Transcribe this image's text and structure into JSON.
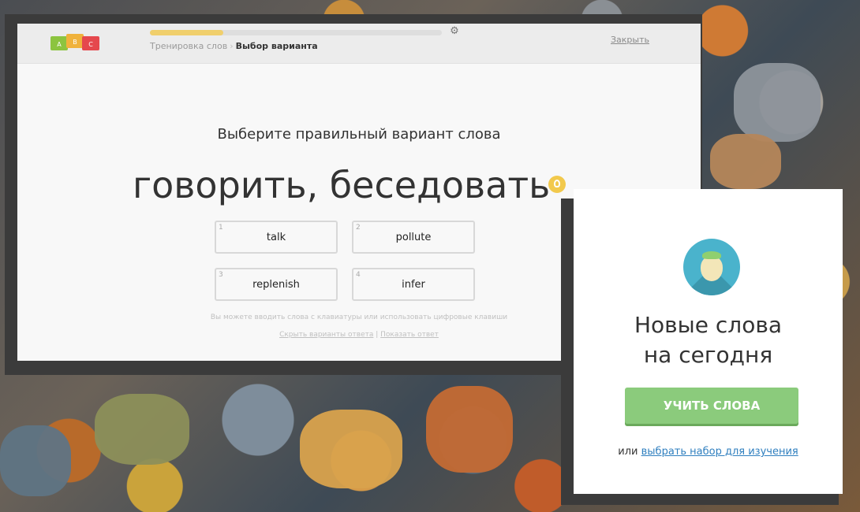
{
  "app": {
    "logo_letters": [
      "A",
      "B",
      "C"
    ],
    "logo_colors": [
      "#8cc43f",
      "#f0b23c",
      "#e5484d"
    ]
  },
  "header": {
    "progress_fraction": 0.25,
    "progress_color": "#f0cf6c",
    "settings_icon": "gear-icon",
    "breadcrumb": [
      "Тренировка слов",
      "Выбор варианта"
    ],
    "close_label": "Закрыть"
  },
  "exercise": {
    "instruction": "Выберите правильный вариант слова",
    "word": "говорить, беседовать",
    "hint_icon": "lightbulb-icon",
    "options": [
      {
        "num": "1",
        "label": "talk"
      },
      {
        "num": "2",
        "label": "pollute"
      },
      {
        "num": "3",
        "label": "replenish"
      },
      {
        "num": "4",
        "label": "infer"
      }
    ],
    "keyboard_note": "Вы можете вводить слова с клавиатуры или использовать цифровые клавиши",
    "hide_options_link": "Скрыть варианты ответа",
    "show_answer_link": "Показать ответ"
  },
  "promo": {
    "icon": "strawberry-icon",
    "headline_line1": "Новые слова",
    "headline_line2": "на сегодня",
    "learn_button": "УЧИТЬ СЛОВА",
    "or_text": "или",
    "choose_set_link": "выбрать набор для изучения",
    "accent_color": "#8bcb7c",
    "link_color": "#2f7fbf"
  }
}
